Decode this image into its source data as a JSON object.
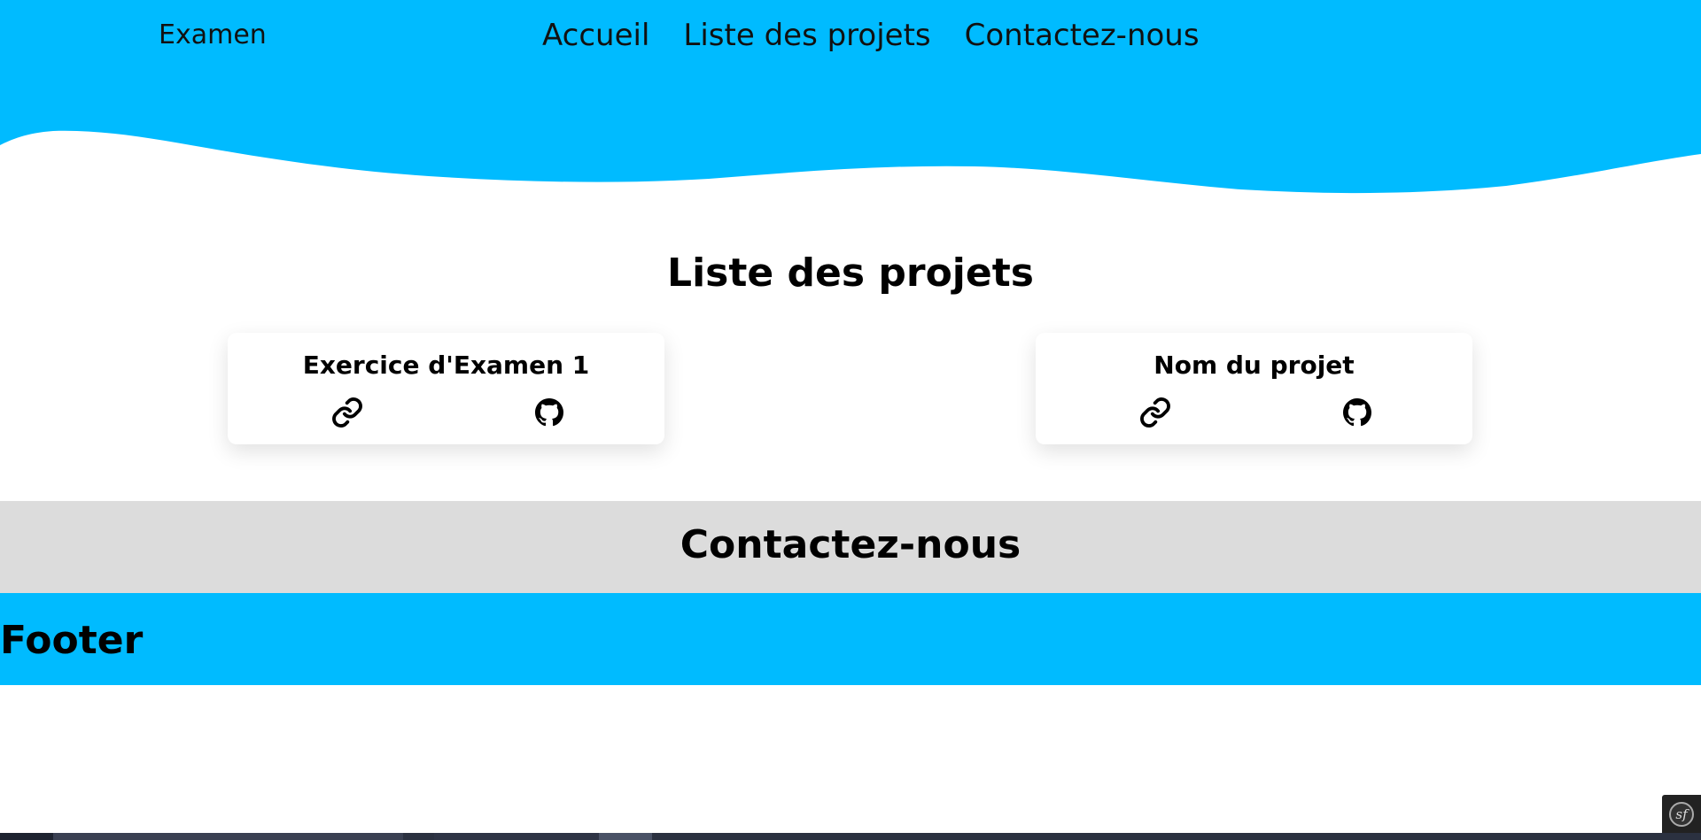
{
  "header": {
    "brand": "Examen",
    "nav": [
      {
        "label": "Accueil"
      },
      {
        "label": "Liste des projets"
      },
      {
        "label": "Contactez-nous"
      }
    ],
    "color": "#00bbff"
  },
  "projects": {
    "title": "Liste des projets",
    "cards": [
      {
        "title": "Exercice d'Examen 1",
        "icons": [
          "link-icon",
          "github-icon"
        ]
      },
      {
        "title": "Nom du projet",
        "icons": [
          "link-icon",
          "github-icon"
        ]
      }
    ]
  },
  "contact": {
    "title": "Contactez-nous",
    "color": "#dcdcdc"
  },
  "footer": {
    "title": "Footer",
    "color": "#00bbff"
  },
  "debug_toolbar": {
    "icon": "symfony-icon",
    "glyph": "sf"
  }
}
